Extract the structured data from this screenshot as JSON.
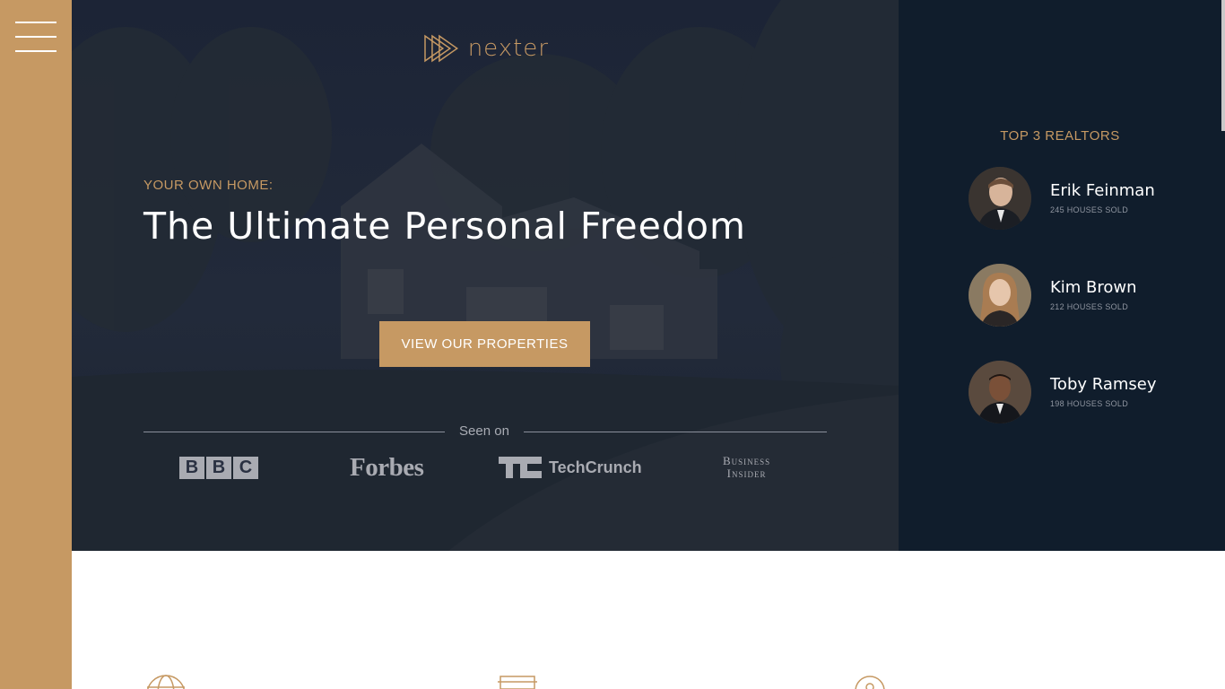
{
  "app": {
    "logo_text": "nexter",
    "accent_color": "#c69963",
    "dark_color": "#101d2c"
  },
  "sidebar": {
    "menu_icon": "hamburger-menu-icon"
  },
  "hero": {
    "subtitle": "YOUR OWN HOME:",
    "title": "The Ultimate Personal Freedom",
    "cta_label": "VIEW OUR PROPERTIES",
    "seen_on_label": "Seen on",
    "press": {
      "bbc": [
        "B",
        "B",
        "C"
      ],
      "forbes": "Forbes",
      "techcrunch": "TechCrunch",
      "business_line1": "Business",
      "business_line2": "Insider"
    }
  },
  "realtors": {
    "heading": "TOP 3 REALTORS",
    "items": [
      {
        "name": "Erik Feinman",
        "sold": "245 HOUSES SOLD"
      },
      {
        "name": "Kim Brown",
        "sold": "212 HOUSES SOLD"
      },
      {
        "name": "Toby Ramsey",
        "sold": "198 HOUSES SOLD"
      }
    ]
  },
  "features": {
    "icons": [
      "globe-icon",
      "house-icon",
      "location-pin-icon"
    ]
  }
}
